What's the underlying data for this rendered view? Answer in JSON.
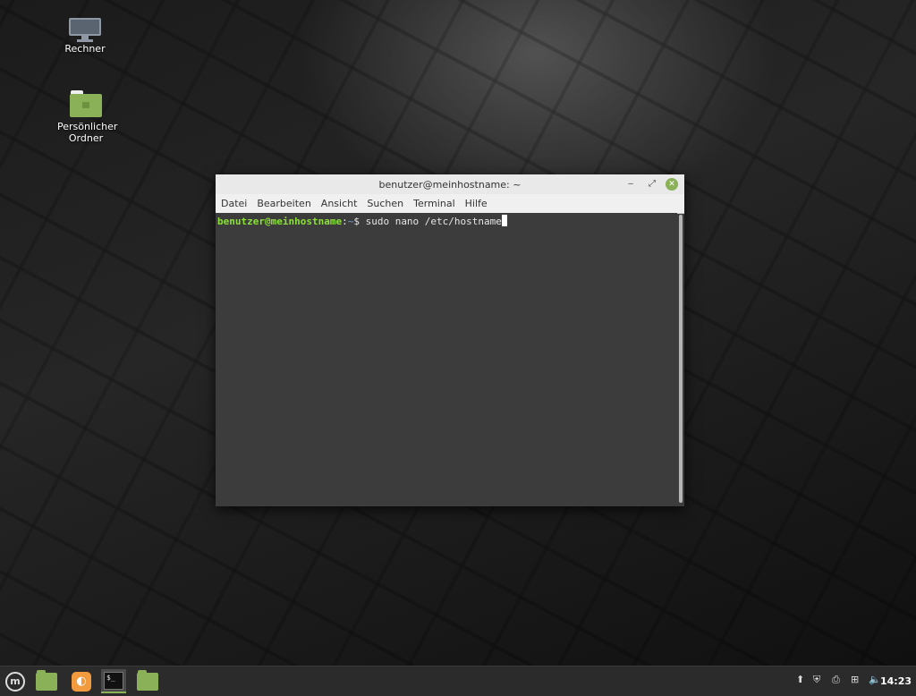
{
  "desktop": {
    "icons": [
      {
        "label": "Rechner",
        "icon": "computer-icon"
      },
      {
        "label": "Persönlicher Ordner",
        "icon": "home-folder-icon"
      }
    ]
  },
  "window": {
    "title": "benutzer@meinhostname: ~",
    "controls": {
      "minimize": "‒",
      "maximize": "⤢",
      "close": "✕"
    },
    "menu": [
      "Datei",
      "Bearbeiten",
      "Ansicht",
      "Suchen",
      "Terminal",
      "Hilfe"
    ],
    "terminal": {
      "prompt_user": "benutzer@meinhostname",
      "prompt_sep": ":",
      "prompt_path": "~",
      "prompt_symbol": "$ ",
      "command": "sudo nano /etc/hostname"
    }
  },
  "panel": {
    "launchers": [
      {
        "name": "menu-button",
        "icon": "linux-mint-logo-icon"
      },
      {
        "name": "files-launcher",
        "icon": "folder-icon"
      },
      {
        "name": "firefox-launcher",
        "icon": "firefox-icon"
      },
      {
        "name": "terminal-launcher",
        "icon": "terminal-icon",
        "active": true
      },
      {
        "name": "files-window",
        "icon": "folder-icon"
      }
    ],
    "terminal_icon_text": "$_",
    "tray": [
      "update-manager-icon",
      "shield-icon",
      "printer-icon",
      "network-icon",
      "volume-icon"
    ],
    "clock": "14:23"
  },
  "colors": {
    "accent": "#8bb158",
    "prompt_green": "#8ae234",
    "prompt_blue": "#729fcf"
  }
}
